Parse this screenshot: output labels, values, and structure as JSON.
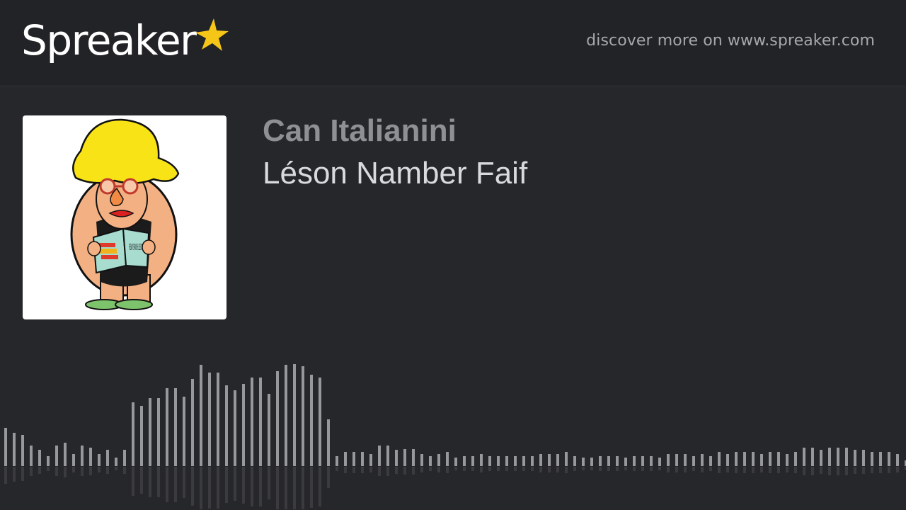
{
  "header": {
    "brand": "Spreaker",
    "discover_text": "discover more on www.spreaker.com"
  },
  "episode": {
    "show_title": "Can Italianini",
    "episode_title": "Léson Namber Faif",
    "cover_book_text": "FREAKY SPANISH LESSONS FAIF"
  },
  "colors": {
    "background": "#26272b",
    "topbar": "#222327",
    "accent_star": "#f5c518",
    "wave_bar": "#97989c"
  },
  "waveform": {
    "levels": [
      0.36,
      0.31,
      0.29,
      0.19,
      0.15,
      0.09,
      0.19,
      0.22,
      0.11,
      0.19,
      0.17,
      0.11,
      0.15,
      0.08,
      0.15,
      0.6,
      0.57,
      0.64,
      0.64,
      0.73,
      0.73,
      0.65,
      0.82,
      0.95,
      0.88,
      0.88,
      0.76,
      0.71,
      0.77,
      0.83,
      0.83,
      0.68,
      0.89,
      0.95,
      0.96,
      0.94,
      0.86,
      0.83,
      0.44,
      0.09,
      0.13,
      0.13,
      0.13,
      0.11,
      0.19,
      0.19,
      0.15,
      0.16,
      0.16,
      0.11,
      0.09,
      0.11,
      0.13,
      0.08,
      0.09,
      0.09,
      0.11,
      0.09,
      0.09,
      0.09,
      0.09,
      0.09,
      0.09,
      0.11,
      0.11,
      0.11,
      0.13,
      0.09,
      0.08,
      0.08,
      0.09,
      0.09,
      0.09,
      0.08,
      0.09,
      0.09,
      0.09,
      0.08,
      0.11,
      0.11,
      0.11,
      0.09,
      0.11,
      0.09,
      0.13,
      0.11,
      0.13,
      0.13,
      0.13,
      0.11,
      0.13,
      0.13,
      0.11,
      0.13,
      0.17,
      0.17,
      0.15,
      0.17,
      0.17,
      0.17,
      0.15,
      0.15,
      0.13,
      0.13,
      0.13,
      0.11,
      0.05
    ]
  }
}
